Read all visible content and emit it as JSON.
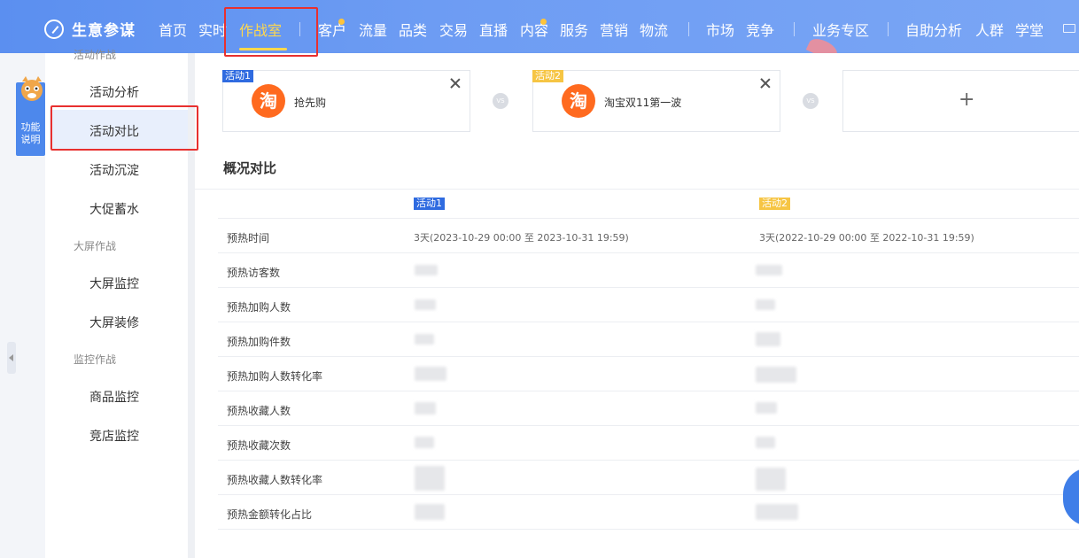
{
  "app": {
    "name": "生意参谋"
  },
  "nav": {
    "items": [
      "首页",
      "实时",
      "作战室",
      "客户",
      "流量",
      "品类",
      "交易",
      "直播",
      "内容",
      "服务",
      "营销",
      "物流",
      "市场",
      "竞争",
      "业务专区",
      "自助分析",
      "人群",
      "学堂"
    ],
    "active": "作战室"
  },
  "leftrail": {
    "func_tab": "功能\n说明"
  },
  "sidebar": {
    "groups": [
      {
        "label": "活动作战",
        "items": [
          "活动分析",
          "活动对比",
          "活动沉淀",
          "大促蓄水"
        ]
      },
      {
        "label": "大屏作战",
        "items": [
          "大屏监控",
          "大屏装修"
        ]
      },
      {
        "label": "监控作战",
        "items": [
          "商品监控",
          "竞店监控"
        ]
      }
    ],
    "active": "活动对比"
  },
  "activities": [
    {
      "tag": "活动1",
      "logo_char": "淘",
      "name": "抢先购",
      "tag_color": "#2f6be0"
    },
    {
      "tag": "活动2",
      "logo_char": "淘",
      "name": "淘宝双11第一波",
      "tag_color": "#f6c544"
    }
  ],
  "vs_label": "VS",
  "add_label": "+",
  "section": {
    "title": "概况对比"
  },
  "table": {
    "col_tags": [
      "活动1",
      "活动2"
    ],
    "rows": [
      {
        "label": "预热时间",
        "v1": "3天(2023-10-29 00:00 至 2023-10-31 19:59)",
        "v2": "3天(2022-10-29 00:00 至 2022-10-31 19:59)"
      },
      {
        "label": "预热访客数",
        "v1": "",
        "v2": ""
      },
      {
        "label": "预热加购人数",
        "v1": "",
        "v2": ""
      },
      {
        "label": "预热加购件数",
        "v1": "",
        "v2": ""
      },
      {
        "label": "预热加购人数转化率",
        "v1": "",
        "v2": ""
      },
      {
        "label": "预热收藏人数",
        "v1": "",
        "v2": ""
      },
      {
        "label": "预热收藏次数",
        "v1": "",
        "v2": ""
      },
      {
        "label": "预热收藏人数转化率",
        "v1": "",
        "v2": ""
      },
      {
        "label": "预热金额转化占比",
        "v1": "",
        "v2": ""
      }
    ]
  },
  "colors": {
    "nav_bg": "#6d9cf3",
    "nav_active": "#ffd84d",
    "highlight": "#e8302f",
    "taobao_orange": "#ff6a1f"
  }
}
